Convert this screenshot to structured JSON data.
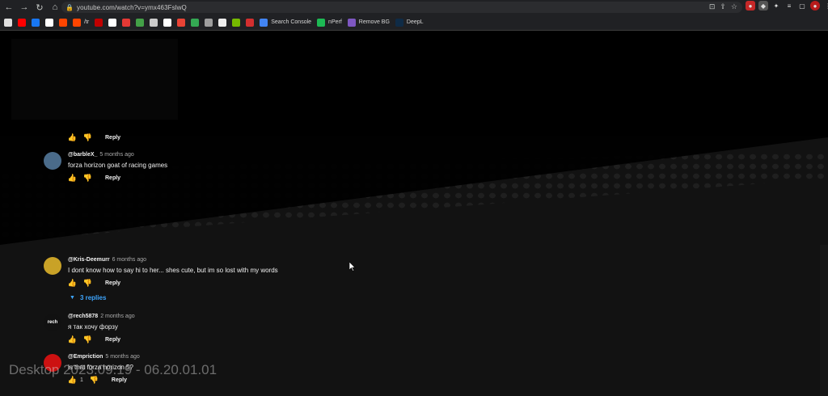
{
  "browser": {
    "url": "youtube.com/watch?v=ymx463FslwQ",
    "bookmarks": [
      {
        "label": "",
        "color": "#e0e0e0"
      },
      {
        "label": "",
        "color": "#ff0000"
      },
      {
        "label": "",
        "color": "#1877f2"
      },
      {
        "label": "",
        "color": "#ffffff"
      },
      {
        "label": "",
        "color": "#ff4500"
      },
      {
        "label": "/tr",
        "color": "#ff4500"
      },
      {
        "label": "",
        "color": "#c00000"
      },
      {
        "label": "",
        "color": "#ffffff"
      },
      {
        "label": "",
        "color": "#e53935"
      },
      {
        "label": "",
        "color": "#43a047"
      },
      {
        "label": "",
        "color": "#cccccc"
      },
      {
        "label": "",
        "color": "#ffffff"
      },
      {
        "label": "",
        "color": "#ea4335"
      },
      {
        "label": "",
        "color": "#34a853"
      },
      {
        "label": "",
        "color": "#9e9e9e"
      },
      {
        "label": "",
        "color": "#eeeeee"
      },
      {
        "label": "",
        "color": "#76b900"
      },
      {
        "label": "",
        "color": "#d32f2f"
      },
      {
        "label": "Search Console",
        "color": "#4285f4"
      },
      {
        "label": "nPerf",
        "color": "#1db954"
      },
      {
        "label": "Remove BG",
        "color": "#7e57c2"
      },
      {
        "label": "DeepL",
        "color": "#0f2b46"
      }
    ]
  },
  "comments": [
    {
      "author": "",
      "time": "",
      "text": "",
      "likes": "",
      "reply": "Reply",
      "avatar_color": "#333333",
      "avatar_text": ""
    },
    {
      "author": "@barbleX_",
      "time": "5 months ago",
      "text": "forza horizon goat of racing games",
      "likes": "",
      "reply": "Reply",
      "avatar_color": "#4a6b8a",
      "avatar_text": ""
    },
    {
      "author": "@Kris-Deemurr",
      "time": "6 months ago",
      "text": "I dont know how to say hi to her... shes cute, but im so lost with my words",
      "likes": "",
      "reply": "Reply",
      "avatar_color": "#c9a227",
      "avatar_text": ""
    },
    {
      "author": "@rech5878",
      "time": "2 months ago",
      "text": "я так хочу форзу",
      "likes": "",
      "reply": "Reply",
      "avatar_color": "#111111",
      "avatar_text": "rech"
    },
    {
      "author": "@Empriction",
      "time": "5 months ago",
      "text": "is that forza horizon 5?",
      "likes": "1",
      "reply": "Reply",
      "avatar_color": "#cc1111",
      "avatar_text": ""
    }
  ],
  "replies_toggle": "3 replies",
  "watermark": "Desktop 2023.09.19 - 06.20.01.01",
  "colors": {
    "link": "#3ea6ff",
    "background": "#0f0f0f"
  }
}
